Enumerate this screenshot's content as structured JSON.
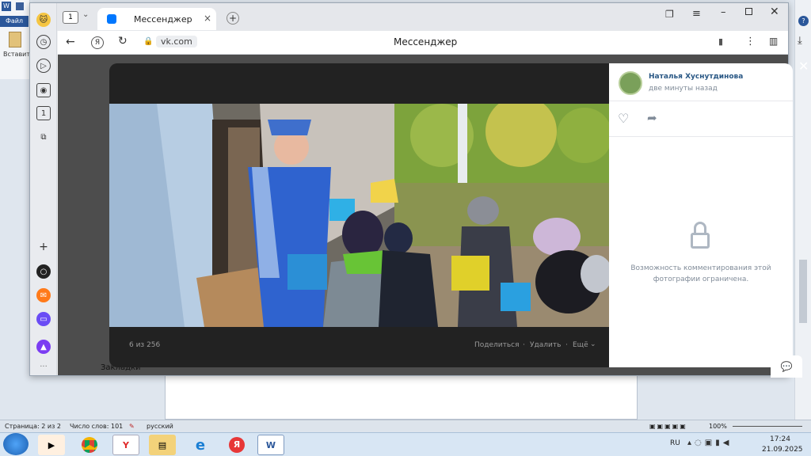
{
  "word": {
    "file_tab": "Файл",
    "paste_label": "Вставить",
    "status": {
      "page": "Страница: 2 из 2",
      "words": "Число слов: 101",
      "language": "русский",
      "zoom": "100%"
    }
  },
  "browser": {
    "tab_counter": "1",
    "tab_title": "Мессенджер",
    "new_tab": "+",
    "address_domain": "vk.com",
    "page_title": "Мессенджер",
    "bookmarks_label": "Закладки"
  },
  "viewer": {
    "counter": "6 из 256",
    "share": "Поделиться",
    "delete": "Удалить",
    "more": "Ещё",
    "author_name": "Наталья Хуснутдинова",
    "posted_time": "две минуты назад",
    "comments_restricted": "Возможность комментирования этой фотографии ограничена."
  },
  "taskbar": {
    "language": "RU",
    "time": "17:24",
    "date": "21.09.2025"
  },
  "colors": {
    "vk_blue": "#0077ff",
    "link_blue": "#2a5885",
    "word_blue": "#2b579a"
  }
}
